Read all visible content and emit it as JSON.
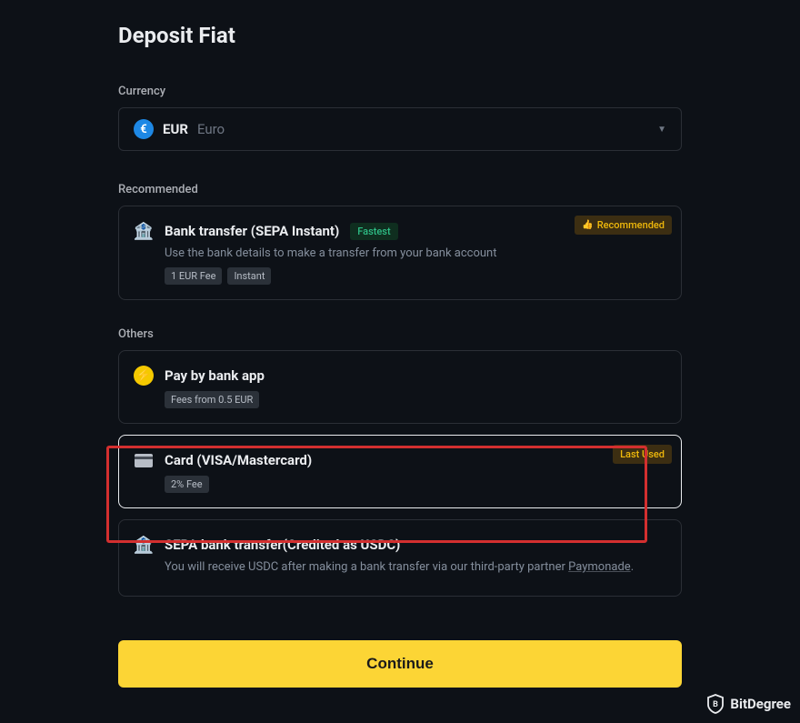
{
  "page_title": "Deposit Fiat",
  "currency": {
    "section_label": "Currency",
    "icon_symbol": "€",
    "code": "EUR",
    "name": "Euro"
  },
  "recommended": {
    "section_label": "Recommended",
    "badge_label": "Recommended",
    "option": {
      "title": "Bank transfer (SEPA Instant)",
      "fastest_badge": "Fastest",
      "description": "Use the bank details to make a transfer from your bank account",
      "fee_badge": "1 EUR Fee",
      "time_badge": "Instant"
    }
  },
  "others": {
    "section_label": "Others",
    "paybank": {
      "title": "Pay by bank app",
      "fee_badge": "Fees from 0.5 EUR"
    },
    "card": {
      "title": "Card (VISA/Mastercard)",
      "fee_badge": "2% Fee",
      "corner_badge": "Last Used"
    },
    "sepa_usdc": {
      "title": "SEPA bank transfer(Credited as USDC)",
      "description_prefix": "You will receive USDC after making a bank transfer via our third-party partner ",
      "partner": "Paymonade",
      "description_suffix": "."
    }
  },
  "continue_label": "Continue",
  "logo_text": "BitDegree"
}
